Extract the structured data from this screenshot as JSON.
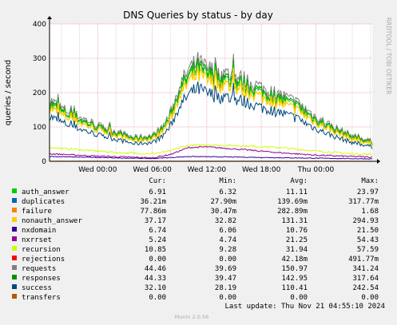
{
  "chart_data": {
    "type": "line",
    "title": "DNS Queries by status - by day",
    "ylabel": "queries / second",
    "watermark": "RRDTOOL / TOBI OETIKER",
    "ylim": [
      0,
      400
    ],
    "yticks": [
      "0",
      "100",
      "200",
      "300",
      "400"
    ],
    "xticks": [
      "Wed 00:00",
      "Wed 06:00",
      "Wed 12:00",
      "Wed 18:00",
      "Thu 00:00"
    ],
    "grid": true,
    "x_span_hours": [
      -5.3,
      30.2
    ],
    "x_tick_hours": [
      0,
      6,
      12,
      18,
      24
    ],
    "colors": {
      "auth_answer": "#00cc00",
      "duplicates": "#0066b3",
      "failure": "#ff8000",
      "nonauth_answer": "#ffcc00",
      "nxdomain": "#330099",
      "nxrrset": "#990099",
      "recursion": "#ccff00",
      "rejections": "#ff0000",
      "requests": "#808080",
      "responses": "#008f00",
      "success": "#00487d",
      "transfers": "#b35a00"
    },
    "series_profiles": {
      "requests_hours": [
        -5.3,
        -4,
        -2,
        0,
        2,
        4,
        6,
        7,
        8,
        9,
        10,
        11,
        12,
        14,
        16,
        18,
        20,
        22,
        24,
        26,
        28,
        30,
        30.2
      ],
      "requests_values": [
        180,
        155,
        130,
        105,
        88,
        70,
        75,
        95,
        140,
        220,
        265,
        290,
        270,
        255,
        240,
        215,
        195,
        170,
        130,
        100,
        75,
        60,
        55
      ],
      "recursion_hours": [
        -5.3,
        -3,
        0,
        3,
        6,
        8,
        9,
        10,
        12,
        16,
        20,
        24,
        28,
        30.2
      ],
      "recursion_values": [
        40,
        36,
        30,
        24,
        22,
        30,
        40,
        46,
        48,
        45,
        40,
        30,
        22,
        20
      ],
      "nxrrset_hours": [
        -5.3,
        0,
        6,
        8,
        10,
        12,
        16,
        20,
        24,
        30.2
      ],
      "nxrrset_values": [
        22,
        15,
        10,
        20,
        40,
        42,
        34,
        25,
        18,
        12
      ]
    }
  },
  "legend": {
    "headers": [
      "Cur:",
      "Min:",
      "Avg:",
      "Max:"
    ],
    "rows": [
      {
        "name": "auth_answer",
        "cur": "6.91",
        "min": "6.32",
        "avg": "11.11",
        "max": "23.97"
      },
      {
        "name": "duplicates",
        "cur": "36.21m",
        "min": "27.90m",
        "avg": "139.69m",
        "max": "317.77m"
      },
      {
        "name": "failure",
        "cur": "77.86m",
        "min": "30.47m",
        "avg": "282.89m",
        "max": "1.68"
      },
      {
        "name": "nonauth_answer",
        "cur": "37.17",
        "min": "32.82",
        "avg": "131.31",
        "max": "294.93"
      },
      {
        "name": "nxdomain",
        "cur": "6.74",
        "min": "6.06",
        "avg": "10.76",
        "max": "21.50"
      },
      {
        "name": "nxrrset",
        "cur": "5.24",
        "min": "4.74",
        "avg": "21.25",
        "max": "54.43"
      },
      {
        "name": "recursion",
        "cur": "10.85",
        "min": "9.28",
        "avg": "31.94",
        "max": "57.59"
      },
      {
        "name": "rejections",
        "cur": "0.00",
        "min": "0.00",
        "avg": "42.18m",
        "max": "491.77m"
      },
      {
        "name": "requests",
        "cur": "44.46",
        "min": "39.69",
        "avg": "150.97",
        "max": "341.24"
      },
      {
        "name": "responses",
        "cur": "44.33",
        "min": "39.47",
        "avg": "142.95",
        "max": "317.64"
      },
      {
        "name": "success",
        "cur": "32.10",
        "min": "28.19",
        "avg": "110.41",
        "max": "242.54"
      },
      {
        "name": "transfers",
        "cur": "0.00",
        "min": "0.00",
        "avg": "0.00",
        "max": "0.00"
      }
    ]
  },
  "footer": {
    "last_update": "Last update: Thu Nov 21 04:55:10 2024",
    "generator": "Munin 2.0.56"
  }
}
